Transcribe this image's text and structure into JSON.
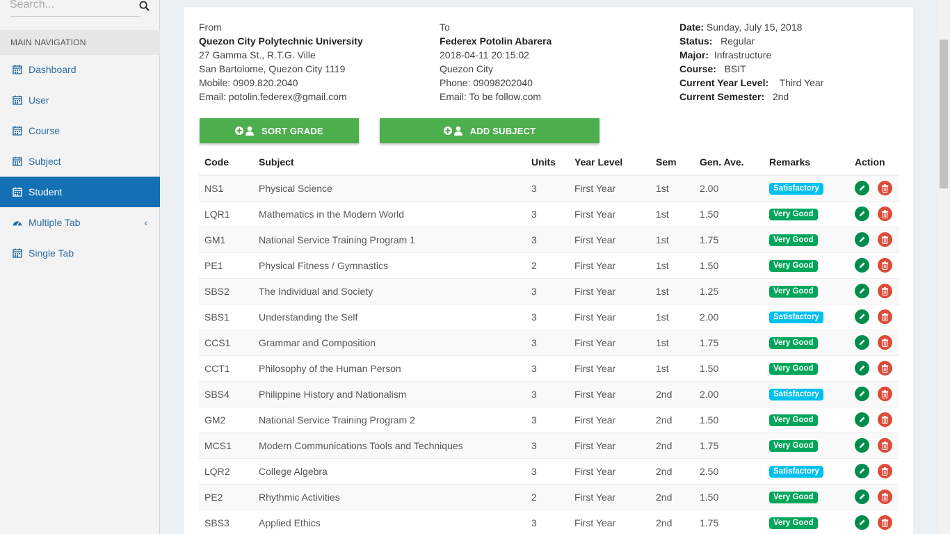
{
  "sidebar": {
    "search_placeholder": "Search...",
    "nav_header": "MAIN NAVIGATION",
    "items": [
      {
        "label": "Dashboard",
        "icon": "calendar-icon"
      },
      {
        "label": "User",
        "icon": "calendar-icon"
      },
      {
        "label": "Course",
        "icon": "calendar-icon"
      },
      {
        "label": "Subject",
        "icon": "calendar-icon"
      },
      {
        "label": "Student",
        "icon": "calendar-icon",
        "active": true
      },
      {
        "label": "Multiple Tab",
        "icon": "dashboard-icon",
        "caret": "‹"
      },
      {
        "label": "Single Tab",
        "icon": "calendar-icon"
      }
    ]
  },
  "from": {
    "label": "From",
    "name": "Quezon City Polytechnic University",
    "address1": "27 Gamma St., R.T.G. Ville",
    "address2": "San Bartolome, Quezon City 1119",
    "mobile": "Mobile: 0909.820.2040",
    "email": "Email: potolin.federex@gmail.com"
  },
  "to": {
    "label": "To",
    "name": "Federex Potolin Abarera",
    "datetime": "2018-04-11 20:15:02",
    "city": "Quezon City",
    "phone": "Phone:  09098202040",
    "email": "Email: To be follow.com"
  },
  "details": {
    "date_label": "Date:",
    "date_value": " Sunday, July 15, 2018",
    "status_label": "Status:",
    "status_value": "Regular",
    "major_label": "Major:",
    "major_value": "Infrastructure",
    "course_label": "Course:",
    "course_value": "BSIT",
    "year_label": "Current Year Level:",
    "year_value": "Third Year",
    "sem_label": "Current Semester:",
    "sem_value": "2nd"
  },
  "buttons": {
    "sort_grade": "SORT GRADE",
    "add_subject": "ADD SUBJECT"
  },
  "table": {
    "headers": [
      "Code",
      "Subject",
      "Units",
      "Year Level",
      "Sem",
      "Gen. Ave.",
      "Remarks",
      "Action"
    ],
    "rows": [
      {
        "code": "NS1",
        "subject": "Physical Science",
        "units": "3",
        "year": "First Year",
        "sem": "1st",
        "ave": "2.00",
        "remarks": "Satisfactory"
      },
      {
        "code": "LQR1",
        "subject": "Mathematics in the Modern World",
        "units": "3",
        "year": "First Year",
        "sem": "1st",
        "ave": "1.50",
        "remarks": "Very Good"
      },
      {
        "code": "GM1",
        "subject": "National Service Training Program 1",
        "units": "3",
        "year": "First Year",
        "sem": "1st",
        "ave": "1.75",
        "remarks": "Very Good"
      },
      {
        "code": "PE1",
        "subject": "Physical Fitness / Gymnastics",
        "units": "2",
        "year": "First Year",
        "sem": "1st",
        "ave": "1.50",
        "remarks": "Very Good"
      },
      {
        "code": "SBS2",
        "subject": "The Individual and Society",
        "units": "3",
        "year": "First Year",
        "sem": "1st",
        "ave": "1.25",
        "remarks": "Very Good"
      },
      {
        "code": "SBS1",
        "subject": "Understanding the Self",
        "units": "3",
        "year": "First Year",
        "sem": "1st",
        "ave": "2.00",
        "remarks": "Satisfactory"
      },
      {
        "code": "CCS1",
        "subject": "Grammar and Composition",
        "units": "3",
        "year": "First Year",
        "sem": "1st",
        "ave": "1.75",
        "remarks": "Very Good"
      },
      {
        "code": "CCT1",
        "subject": "Philosophy of the Human Person",
        "units": "3",
        "year": "First Year",
        "sem": "1st",
        "ave": "1.50",
        "remarks": "Very Good"
      },
      {
        "code": "SBS4",
        "subject": "Philippine History and Nationalism",
        "units": "3",
        "year": "First Year",
        "sem": "2nd",
        "ave": "2.00",
        "remarks": "Satisfactory"
      },
      {
        "code": "GM2",
        "subject": "National Service Training Program 2",
        "units": "3",
        "year": "First Year",
        "sem": "2nd",
        "ave": "1.50",
        "remarks": "Very Good"
      },
      {
        "code": "MCS1",
        "subject": "Modern Communications Tools and Techniques",
        "units": "3",
        "year": "First Year",
        "sem": "2nd",
        "ave": "1.75",
        "remarks": "Very Good"
      },
      {
        "code": "LQR2",
        "subject": "College Algebra",
        "units": "3",
        "year": "First Year",
        "sem": "2nd",
        "ave": "2.50",
        "remarks": "Satisfactory"
      },
      {
        "code": "PE2",
        "subject": "Rhythmic Activities",
        "units": "2",
        "year": "First Year",
        "sem": "2nd",
        "ave": "1.50",
        "remarks": "Very Good"
      },
      {
        "code": "SBS3",
        "subject": "Applied Ethics",
        "units": "3",
        "year": "First Year",
        "sem": "2nd",
        "ave": "1.75",
        "remarks": "Very Good"
      }
    ]
  },
  "colors": {
    "active_nav": "#1470b4",
    "button_green": "#4cae4c",
    "badge_very_good": "#00a65a",
    "badge_satisfactory": "#00c0ef",
    "edit_icon": "#008d4c",
    "delete_icon": "#dd4b39"
  }
}
